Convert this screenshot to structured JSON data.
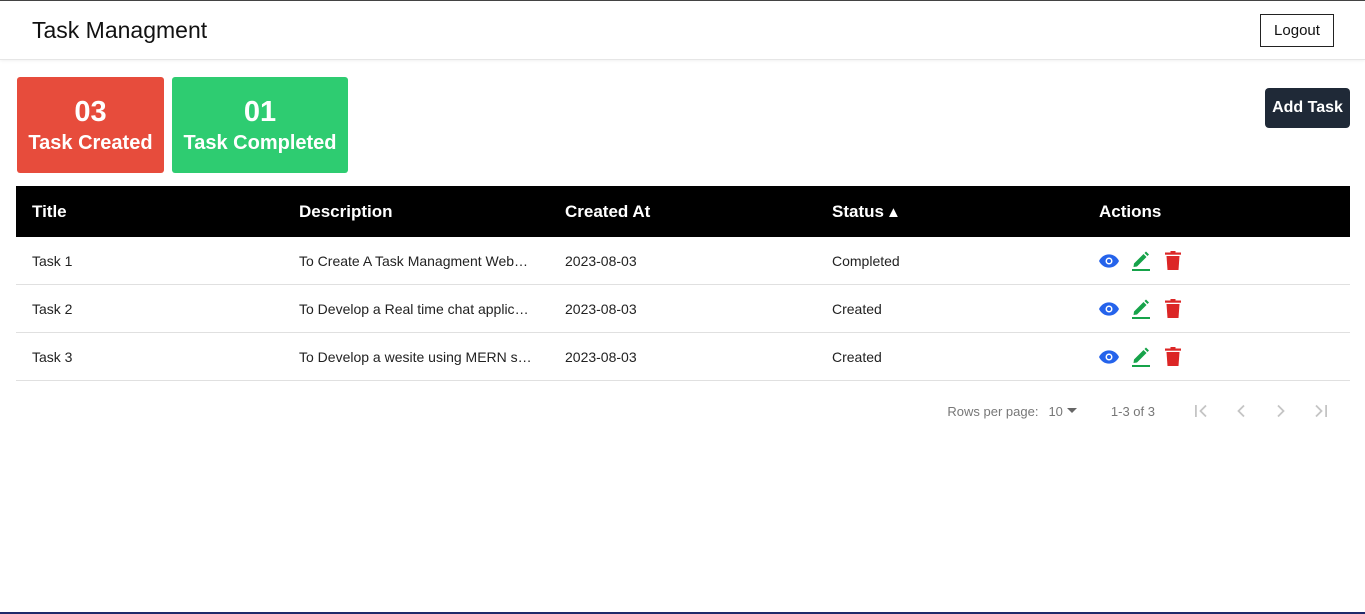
{
  "navbar": {
    "brand": "Task Managment",
    "logout_label": "Logout"
  },
  "stats": {
    "created": {
      "count": "03",
      "label": "Task Created",
      "color": "#e74c3c"
    },
    "completed": {
      "count": "01",
      "label": "Task Completed",
      "color": "#2ecc71"
    }
  },
  "toolbar": {
    "add_task_label": "Add Task"
  },
  "table": {
    "headers": {
      "title": "Title",
      "description": "Description",
      "created_at": "Created At",
      "status": "Status",
      "actions": "Actions"
    },
    "sort": {
      "column": "Status",
      "direction": "asc",
      "arrow": "▲"
    },
    "rows": [
      {
        "title": "Task 1",
        "description": "To Create A Task Managment Website",
        "created_at": "2023-08-03",
        "status": "Completed"
      },
      {
        "title": "Task 2",
        "description": "To Develop a Real time chat application",
        "created_at": "2023-08-03",
        "status": "Created"
      },
      {
        "title": "Task 3",
        "description": "To Develop a wesite using MERN stack",
        "created_at": "2023-08-03",
        "status": "Created"
      }
    ],
    "action_icons": [
      "eye-icon",
      "pencil-icon",
      "trash-icon"
    ],
    "action_colors": {
      "view": "#2563eb",
      "edit": "#16a34a",
      "delete": "#dc2626"
    }
  },
  "pagination": {
    "rows_per_page_label": "Rows per page:",
    "rows_per_page_value": "10",
    "range_label": "1-3 of 3"
  }
}
